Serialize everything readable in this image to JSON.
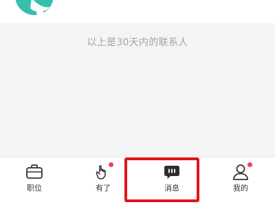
{
  "content": {
    "notice_text": "以上是30天内的联系人"
  },
  "tabbar": {
    "items": [
      {
        "label": "职位",
        "icon": "briefcase-icon",
        "badge": false
      },
      {
        "label": "有了",
        "icon": "hand-icon",
        "badge": true
      },
      {
        "label": "消息",
        "icon": "chat-bubble-icon",
        "badge": false,
        "active": true
      },
      {
        "label": "我的",
        "icon": "person-icon",
        "badge": true
      }
    ]
  },
  "colors": {
    "accent_teal": "#35c0ae",
    "badge": "#f0435a",
    "highlight": "#e0141b"
  }
}
